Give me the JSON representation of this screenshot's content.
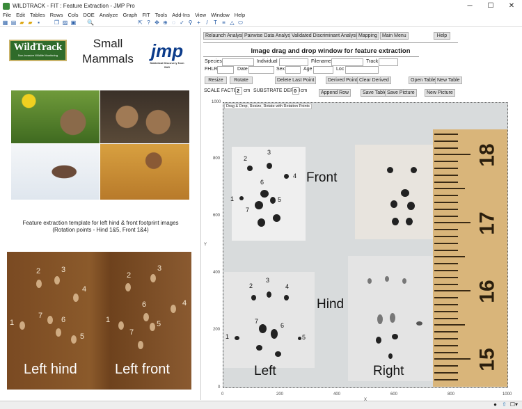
{
  "window": {
    "title": "WILDTRACK - FIT : Feature Extraction - JMP Pro",
    "min": "─",
    "max": "☐",
    "close": "✕"
  },
  "menu": [
    "File",
    "Edit",
    "Tables",
    "Rows",
    "Cols",
    "DOE",
    "Analyze",
    "Graph",
    "FIT",
    "Tools",
    "Add-Ins",
    "View",
    "Window",
    "Help"
  ],
  "left": {
    "wildtrack": "WildTrack",
    "wildtrack_tag": "Non-invasive Wildlife Monitoring",
    "small_mammals": "Small Mammals",
    "jmp": "jmp",
    "jmp_tag": "Statistical Discovery from SAS",
    "caption1": "Feature extraction template for left hind & front footprint images",
    "caption2": "(Rotation points - Hind 1&5, Front 1&4)",
    "left_hind": "Left hind",
    "left_front": "Left front"
  },
  "buttons": {
    "relaunch": "Relaunch Analysis",
    "pairwise": "Pairwise Data Analysis",
    "vda": "Validated Discriminant Analysis",
    "mapping": "Mapping",
    "main_menu": "Main Menu",
    "help": "Help",
    "resize": "Resize",
    "rotate": "Rotate",
    "delete_last": "Delete Last Point",
    "derived": "Derived Points",
    "clear_derived": "Clear Derived",
    "open_table": "Open Table",
    "new_table": "New Table",
    "append_row": "Append Row",
    "save_table": "Save Table",
    "save_picture": "Save Picture",
    "new_picture": "New Picture"
  },
  "header": "Image drag and drop window for feature extraction",
  "fields": {
    "species": "Species",
    "individual": "Individual",
    "filename": "Filename",
    "track": "Track",
    "fhlr": "FHLR",
    "date": "Date",
    "sex": "Sex",
    "age": "Age",
    "loc": "Loc",
    "scale_factor_label": "SCALE FACTOR",
    "scale_factor": "2",
    "cm1": "cm",
    "substrate_label": "SUBSTRATE DEPTH",
    "substrate": "0",
    "cm2": "cm"
  },
  "plot": {
    "frame_label": "Drag & Drop, Resize, Rotate with Rotation Points",
    "xlabel": "X",
    "ylabel": "Y",
    "xticks": [
      "0",
      "200",
      "400",
      "600",
      "800",
      "1000"
    ],
    "yticks": [
      "0",
      "200",
      "400",
      "600",
      "800",
      "1000"
    ],
    "front": "Front",
    "hind": "Hind",
    "left": "Left",
    "right": "Right",
    "ruler": [
      "15",
      "16",
      "17",
      "18"
    ]
  }
}
